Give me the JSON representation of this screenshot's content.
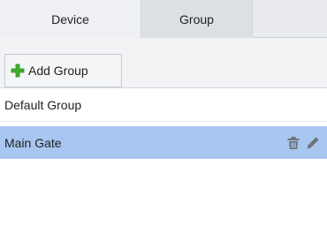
{
  "tabs": [
    {
      "label": "Device"
    },
    {
      "label": "Group",
      "selected": true
    }
  ],
  "toolbar": {
    "add_group_label": "Add Group",
    "add_icon": "plus-icon",
    "add_icon_color": "#3fae2a"
  },
  "groups": [
    {
      "name": "Default Group",
      "selected": false
    },
    {
      "name": "Main Gate",
      "selected": true,
      "actions": [
        "delete-icon",
        "edit-icon"
      ]
    }
  ],
  "colors": {
    "selection": "#a7c6f0",
    "icon": "#6e7177"
  }
}
